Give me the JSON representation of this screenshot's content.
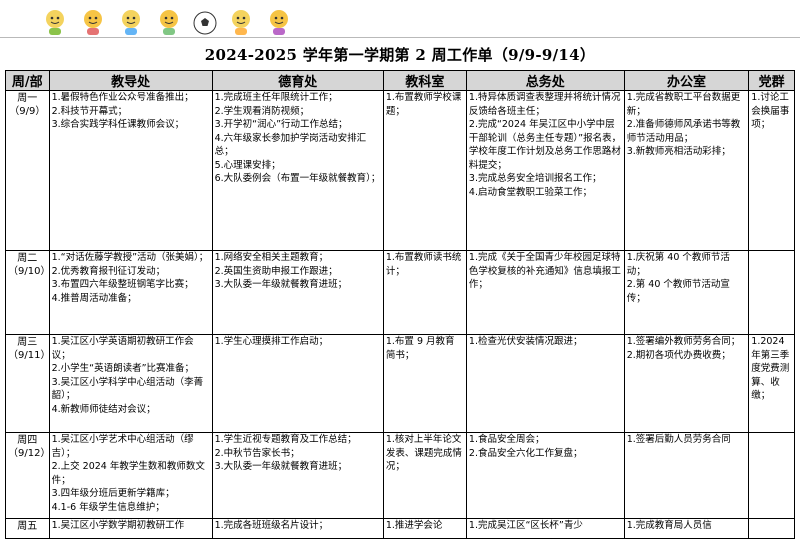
{
  "title": "2024-2025 学年第一学期第 2 周工作单（9/9-9/14）",
  "header_decoration": "cartoon-mascots-row",
  "columns": [
    "周/部",
    "教导处",
    "德育处",
    "教科室",
    "总务处",
    "办公室",
    "党群"
  ],
  "rows": [
    {
      "day": "周一",
      "date": "（9/9）",
      "cells": [
        [
          "1.暑假特色作业公众号准备推出；",
          "2.科技节开幕式；",
          "3.综合实践学科任课教师会议；"
        ],
        [
          "1.完成班主任年限统计工作；",
          "2.学生观看消防视频；",
          "3.开学初“润心”行动工作总结；",
          "4.六年级家长参加护学岗活动安排汇总；",
          "5.心理课安排；",
          "6.大队委例会（布置一年级就餐教育）；"
        ],
        [
          "1.布置教师学校课题；"
        ],
        [
          "1.特异体质调查表整理并将统计情况反馈给各班主任；",
          "2.完成“2024 年吴江区中小学中层干部轮训（总务主任专题）”报名表，学校年度工作计划及总务工作思路材料提交；",
          "3.完成总务安全培训报名工作；",
          "4.启动食堂教职工验菜工作；"
        ],
        [
          "1.完成省教职工平台数据更新；",
          "2.准备师德师风承诺书等教师节活动用品；",
          "3.新教师亮相活动彩排；"
        ],
        [
          "1.讨论工会换届事项；"
        ]
      ]
    },
    {
      "day": "周二",
      "date": "（9/10）",
      "cells": [
        [
          "1.“对话佐藤学教授”活动（张美娟）；",
          "2.优秀教育报刊征订发动；",
          "3.布置四六年级整班钢笔字比赛；",
          "4.推普周活动准备；"
        ],
        [
          "1.网络安全相关主题教育；",
          "2.英国生资助申报工作跟进；",
          "3.大队委一年级就餐教育进班；"
        ],
        [
          "1.布置教师读书统计；"
        ],
        [
          "1.完成《关于全国青少年校园足球特色学校复核的补充通知》信息填报工作；"
        ],
        [
          "1.庆祝第 40 个教师节活动；",
          "2.第 40 个教师节活动宣传；"
        ],
        []
      ]
    },
    {
      "day": "周三",
      "date": "（9/11）",
      "cells": [
        [
          "1.吴江区小学英语期初教研工作会议；",
          "2.小学生“英语朗读者”比赛准备；",
          "3.吴江区小学科学中心组活动（李菁韶）；",
          "4.新教师师徒结对会议；"
        ],
        [
          "1.学生心理摸排工作启动；"
        ],
        [
          "1.布置 9 月教育简书；"
        ],
        [
          "1.检查光伏安装情况跟进；"
        ],
        [
          "1.签署编外教师劳务合同；",
          "2.期初各项代办费收费；"
        ],
        [
          "1.2024年第三季度党费测算、收缴；"
        ]
      ]
    },
    {
      "day": "周四",
      "date": "（9/12）",
      "cells": [
        [
          "1.吴江区小学艺术中心组活动（缪吉）；",
          "2.上交 2024 年教学生数和教师数文件；",
          "3.四年级分班后更新学籍库；",
          "4.1-6 年级学生信息维护；"
        ],
        [
          "1.学生近视专题教育及工作总结；",
          "2.中秋节告家长书；",
          "3.大队委一年级就餐教育进班；"
        ],
        [
          "1.核对上半年论文发表、课题完成情况；"
        ],
        [
          "1.食品安全周会；",
          "2.食品安全六化工作复盘；"
        ],
        [
          "1.签署后勤人员劳务合同"
        ],
        []
      ]
    },
    {
      "day": "周五",
      "date": "",
      "cells": [
        [
          "1.吴江区小学数学期初教研工作"
        ],
        [
          "1.完成各班班级名片设计；"
        ],
        [
          "1.推进学会论"
        ],
        [
          "1.完成吴江区“区长杯”青少"
        ],
        [
          "1.完成教育局人员信"
        ],
        []
      ]
    }
  ]
}
